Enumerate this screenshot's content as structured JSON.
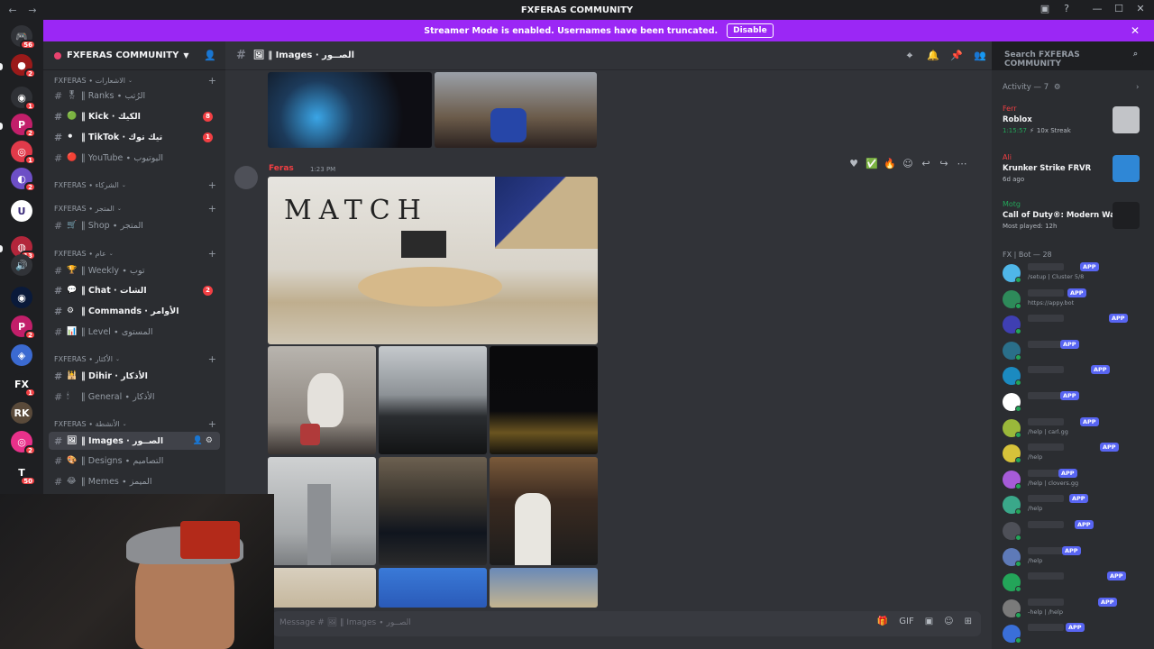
{
  "window": {
    "title": "FXFERAS COMMUNITY",
    "back": "←",
    "forward": "→"
  },
  "banner": {
    "text": "Streamer Mode is enabled. Usernames have been truncated.",
    "disable_label": "Disable",
    "close": "✕"
  },
  "rail": {
    "servers": [
      {
        "glyph": "🎮",
        "badge": "56",
        "color": "#313338"
      },
      {
        "glyph": "●",
        "badge": "2",
        "color": "#9a1a1a"
      },
      {
        "glyph": "◉",
        "badge": "1",
        "color": "#2f3136"
      },
      {
        "glyph": "P",
        "badge": "2",
        "color": "#c21f6a"
      },
      {
        "glyph": "◎",
        "badge": "1",
        "color": "#e03a4a"
      },
      {
        "glyph": "◐",
        "badge": "2",
        "color": "#6d4fc6"
      },
      {
        "glyph": "U",
        "badge": "",
        "color": "#ffffff"
      },
      {
        "glyph": "◍",
        "badge": "13",
        "color": "#b3263b"
      },
      {
        "glyph": "🔊",
        "badge": "",
        "color": "#313338"
      },
      {
        "glyph": "◉",
        "badge": "",
        "color": "#0a1a3a"
      },
      {
        "glyph": "P",
        "badge": "2",
        "color": "#c21f6a"
      },
      {
        "glyph": "◈",
        "badge": "",
        "color": "#3b6ad1"
      },
      {
        "glyph": "FX",
        "badge": "1",
        "color": "#1e1f22"
      },
      {
        "glyph": "RK",
        "badge": "",
        "color": "#5a4a3a"
      },
      {
        "glyph": "◎",
        "badge": "2",
        "color": "#e8318a"
      },
      {
        "glyph": "T",
        "badge": "50",
        "color": "#1e1f22"
      }
    ]
  },
  "sidebar": {
    "server_name": "FXFERAS COMMUNITY",
    "categories": [
      {
        "label": "FXFERAS ∙ الاشعارات"
      },
      {
        "label": "FXFERAS ∙ الشركاء"
      },
      {
        "label": "FXFERAS ∙ المتجر"
      },
      {
        "label": "FXFERAS ∙ عام"
      },
      {
        "label": "FXFERAS ∙ الأكثار"
      },
      {
        "label": "FXFERAS ∙ الأنشطة"
      }
    ],
    "channels": [
      {
        "emoji": "🎖",
        "label": "‖ Ranks ∙ الرُتب",
        "badge": ""
      },
      {
        "emoji": "🟢",
        "label": "‖ Kick ∙ الكيك",
        "badge": "8"
      },
      {
        "emoji": "⚫",
        "label": "‖ TikTok ∙ تيك توك",
        "badge": "1"
      },
      {
        "emoji": "🔴",
        "label": "‖ YouTube ∙ اليوتيوب",
        "badge": ""
      },
      {
        "emoji": "🛒",
        "label": "‖ Shop ∙ المتجر",
        "badge": ""
      },
      {
        "emoji": "🏆",
        "label": "‖ Weekly ∙ توب",
        "badge": ""
      },
      {
        "emoji": "💬",
        "label": "‖ Chat ∙ الشات",
        "badge": "2"
      },
      {
        "emoji": "⚙",
        "label": "‖ Commands ∙ الأوامر",
        "badge": ""
      },
      {
        "emoji": "📊",
        "label": "‖ Level ∙ المستوى",
        "badge": ""
      },
      {
        "emoji": "🕌",
        "label": "‖ Dihir ∙ الأذكار",
        "badge": ""
      },
      {
        "emoji": "🕯",
        "label": "‖ General ∙ الأذكار",
        "badge": ""
      },
      {
        "emoji": "🖼",
        "label": "‖ Images ∙ الصــور",
        "badge": ""
      },
      {
        "emoji": "🎨",
        "label": "‖ Designs ∙ التصاميم",
        "badge": ""
      },
      {
        "emoji": "😂",
        "label": "‖ Memes ∙ الميمز",
        "badge": ""
      }
    ]
  },
  "main": {
    "channel_name": "🖼 ‖ Images ∙ الصــور",
    "search_placeholder": "Search FXFERAS COMMUNITY",
    "message": {
      "author": "Feras",
      "timestamp": "1:23 PM"
    },
    "photo_caption": "MATCH",
    "composer_placeholder": "Message # 🖼 ‖ Images ∙ الصــور",
    "reactions": [
      "♥",
      "✅",
      "🔥"
    ],
    "hover_tools": [
      "☺",
      "↩",
      "↪",
      "⋯"
    ],
    "composer_tools": [
      "🎁",
      "GIF",
      "▣",
      "☺",
      "⊞"
    ]
  },
  "members": {
    "activity_header": "Activity — 7",
    "activities": [
      {
        "who": "Ferr",
        "game": "Roblox",
        "sub": "",
        "time": "1:15:57",
        "extra": "10x Streak",
        "color": "#c2c4c8"
      },
      {
        "who": "Ali",
        "game": "Krunker Strike FRVR",
        "sub": "6d ago",
        "time": "",
        "extra": "",
        "color": "#2f87d6"
      },
      {
        "who": "Motg",
        "game": "Call of Duty®: Modern Warf...",
        "sub": "Most played: 12h",
        "time": "",
        "extra": "",
        "color": "#1e1f22"
      }
    ],
    "group_header": "FX | Bot — 28",
    "bots": [
      {
        "app": "APP",
        "desc": "/setup | Cluster 5/8",
        "color": "#4fb6e8"
      },
      {
        "app": "APP",
        "desc": "https://appy.bot",
        "color": "#2e8a5a"
      },
      {
        "app": "APP",
        "desc": "",
        "color": "#3f3fb2"
      },
      {
        "app": "APP",
        "desc": "",
        "color": "#2a6f8a"
      },
      {
        "app": "APP",
        "desc": "",
        "color": "#1b8ac0"
      },
      {
        "app": "APP",
        "desc": "",
        "color": "#ffffff"
      },
      {
        "app": "APP",
        "desc": "/help | carl.gg",
        "color": "#9ab83a"
      },
      {
        "app": "APP",
        "desc": "/help",
        "color": "#d6c23a"
      },
      {
        "app": "APP",
        "desc": "/help | clovers.gg",
        "color": "#a65bd8"
      },
      {
        "app": "APP",
        "desc": "/help",
        "color": "#3aa88a"
      },
      {
        "app": "APP",
        "desc": "",
        "color": "#4e5058"
      },
      {
        "app": "APP",
        "desc": "/help",
        "color": "#5e7ab8"
      },
      {
        "app": "APP",
        "desc": "",
        "color": "#23a559"
      },
      {
        "app": "APP",
        "desc": "-help | /help",
        "color": "#7a7a7a"
      },
      {
        "app": "APP",
        "desc": "",
        "color": "#3a6fd8"
      }
    ]
  }
}
